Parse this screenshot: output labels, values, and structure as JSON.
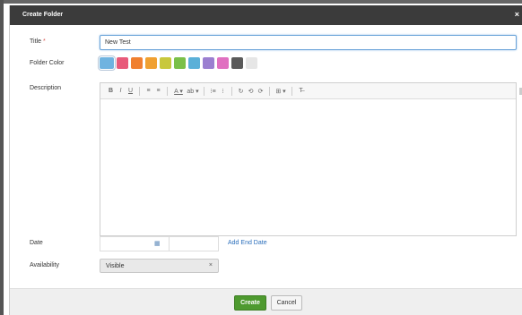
{
  "dialog": {
    "title": "Create Folder",
    "close_symbol": "×"
  },
  "form": {
    "title_label": "Title",
    "required_mark": "*",
    "title_value": "New Test",
    "color_label": "Folder Color",
    "description_label": "Description",
    "date_label": "Date",
    "add_end_date_label": "Add End Date",
    "availability_label": "Availability",
    "availability_value": "Visible",
    "availability_clear": "×"
  },
  "folder_colors": [
    "#6fb3e0",
    "#e85a7a",
    "#f08030",
    "#f0a030",
    "#c8c83c",
    "#7ac048",
    "#5ab0d8",
    "#9b7fd0",
    "#e070c0",
    "#5a5a5a",
    "#e6e6e6"
  ],
  "selected_color_index": 0,
  "toolbar": {
    "bold": "B",
    "italic": "I",
    "underline": "U",
    "align_left": "≡",
    "align_right": "≡",
    "font_color": "A ▾",
    "highlight": "ab ▾",
    "ordered_list": "⁝≡",
    "unordered_list": "⁝",
    "link": "↻",
    "image": "⟲",
    "table": "⟳",
    "more": "⊞ ▾",
    "clear_format": "T̶"
  },
  "icons": {
    "calendar": "▦"
  },
  "footer": {
    "create_label": "Create",
    "cancel_label": "Cancel"
  }
}
